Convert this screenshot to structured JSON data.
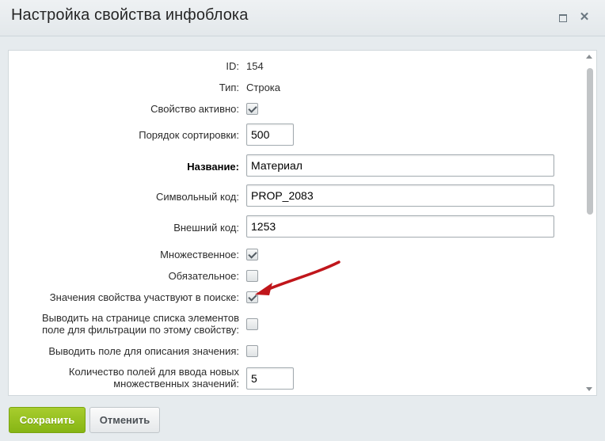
{
  "window": {
    "title": "Настройка свойства инфоблока",
    "maximize_icon": "maximize-icon",
    "close_icon": "close-icon",
    "close_glyph": "✕"
  },
  "form": {
    "id": {
      "label": "ID:",
      "value": "154"
    },
    "type": {
      "label": "Тип:",
      "value": "Строка"
    },
    "active": {
      "label": "Свойство активно:",
      "checked": true
    },
    "sort": {
      "label": "Порядок сортировки:",
      "value": "500"
    },
    "name": {
      "label": "Название:",
      "value": "Материал"
    },
    "code": {
      "label": "Символьный код:",
      "value": "PROP_2083"
    },
    "xml_id": {
      "label": "Внешний код:",
      "value": "1253"
    },
    "multiple": {
      "label": "Множественное:",
      "checked": true
    },
    "required": {
      "label": "Обязательное:",
      "checked": false
    },
    "searchable": {
      "label": "Значения свойства участвуют в поиске:",
      "checked": true
    },
    "filtrable_line1": "Выводить на странице списка элементов",
    "filtrable_line2": "поле для фильтрации по этому свойству:",
    "filtrable_checked": false,
    "with_description": {
      "label": "Выводить поле для описания значения:",
      "checked": false
    },
    "multiple_cnt_line1": "Количество полей для ввода новых",
    "multiple_cnt_line2": "множественных значений:",
    "multiple_cnt_value": "5"
  },
  "buttons": {
    "save": "Сохранить",
    "cancel": "Отменить"
  },
  "colors": {
    "accent_green": "#8fbd1b",
    "annotation_arrow": "#c0161b"
  }
}
